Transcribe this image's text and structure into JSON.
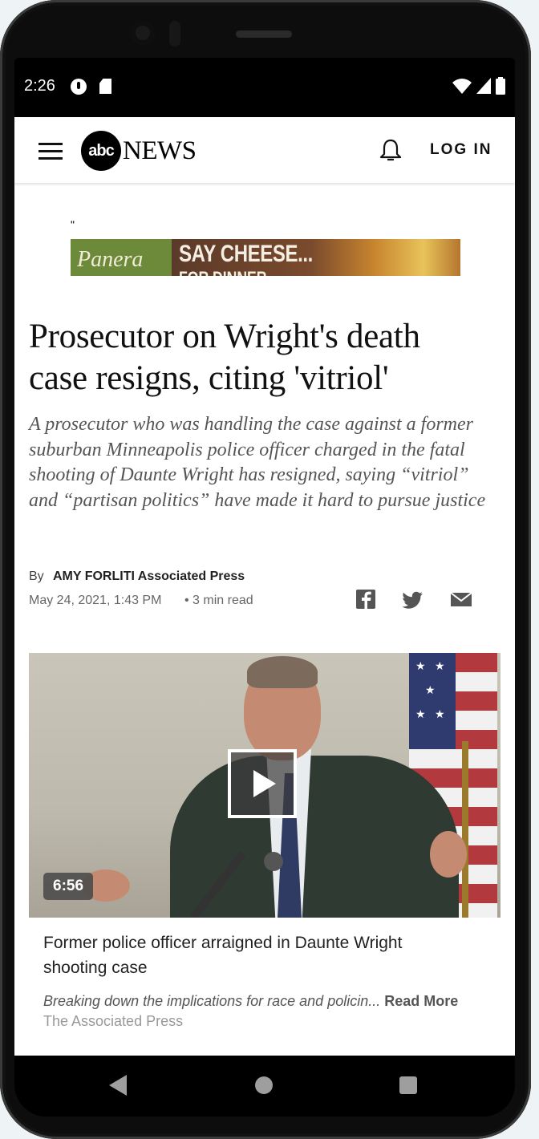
{
  "status_bar": {
    "time": "2:26"
  },
  "header": {
    "logo_abc": "abc",
    "logo_news": "NEWS",
    "login_label": "LOG IN"
  },
  "ad": {
    "quote_mark": "\"",
    "brand": "Panera",
    "headline": "SAY CHEESE...",
    "subline": "FOR DINNER"
  },
  "article": {
    "headline": "Prosecutor on Wright's death case resigns, citing 'vitriol'",
    "dek": "A prosecutor who was handling the case against a former suburban Minneapolis police officer charged in the fatal shooting of Daunte Wright has resigned, saying “vitriol” and “partisan politics” have made it hard to pursue justice",
    "byline_prefix": "By",
    "author": "AMY FORLITI Associated Press",
    "date": "May 24, 2021, 1:43 PM",
    "read_time": "• 3 min read"
  },
  "video": {
    "duration": "6:56",
    "title": "Former police officer arraigned in Daunte Wright shooting case",
    "description": "Breaking down the implications for race and policin...",
    "read_more": "Read More",
    "source": "The Associated Press"
  },
  "colors": {
    "background": "#ffffff",
    "text": "#111111",
    "muted": "#666666",
    "phone_frame": "#0d0d0d"
  }
}
